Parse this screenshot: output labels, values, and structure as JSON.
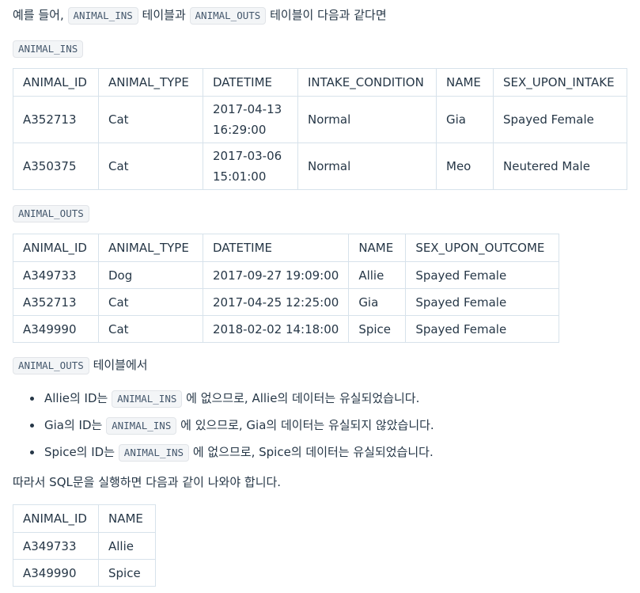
{
  "intro": {
    "prefix": "예를 들어, ",
    "code1": "ANIMAL_INS",
    "mid": " 테이블과 ",
    "code2": "ANIMAL_OUTS",
    "suffix": " 테이블이 다음과 같다면"
  },
  "ins_label": "ANIMAL_INS",
  "ins_table": {
    "headers": [
      "ANIMAL_ID",
      "ANIMAL_TYPE",
      "DATETIME",
      "INTAKE_CONDITION",
      "NAME",
      "SEX_UPON_INTAKE"
    ],
    "rows": [
      {
        "id": "A352713",
        "type": "Cat",
        "dt1": "2017-04-13",
        "dt2": "16:29:00",
        "cond": "Normal",
        "name": "Gia",
        "sex": "Spayed Female"
      },
      {
        "id": "A350375",
        "type": "Cat",
        "dt1": "2017-03-06",
        "dt2": "15:01:00",
        "cond": "Normal",
        "name": "Meo",
        "sex": "Neutered Male"
      }
    ]
  },
  "outs_label": "ANIMAL_OUTS",
  "outs_table": {
    "headers": [
      "ANIMAL_ID",
      "ANIMAL_TYPE",
      "DATETIME",
      "NAME",
      "SEX_UPON_OUTCOME"
    ],
    "rows": [
      [
        "A349733",
        "Dog",
        "2017-09-27 19:09:00",
        "Allie",
        "Spayed Female"
      ],
      [
        "A352713",
        "Cat",
        "2017-04-25 12:25:00",
        "Gia",
        "Spayed Female"
      ],
      [
        "A349990",
        "Cat",
        "2018-02-02 14:18:00",
        "Spice",
        "Spayed Female"
      ]
    ]
  },
  "outs_note": {
    "code": "ANIMAL_OUTS",
    "text": " 테이블에서"
  },
  "bullets": [
    {
      "pre": "Allie의 ID는 ",
      "code": "ANIMAL_INS",
      "post": " 에 없으므로, Allie의 데이터는 유실되었습니다."
    },
    {
      "pre": "Gia의 ID는 ",
      "code": "ANIMAL_INS",
      "post": " 에 있으므로, Gia의 데이터는 유실되지 않았습니다."
    },
    {
      "pre": "Spice의 ID는 ",
      "code": "ANIMAL_INS",
      "post": " 에 없으므로, Spice의 데이터는 유실되었습니다."
    }
  ],
  "conclusion": "따라서 SQL문을 실행하면 다음과 같이 나와야 합니다.",
  "result_table": {
    "headers": [
      "ANIMAL_ID",
      "NAME"
    ],
    "rows": [
      [
        "A349733",
        "Allie"
      ],
      [
        "A349990",
        "Spice"
      ]
    ]
  }
}
